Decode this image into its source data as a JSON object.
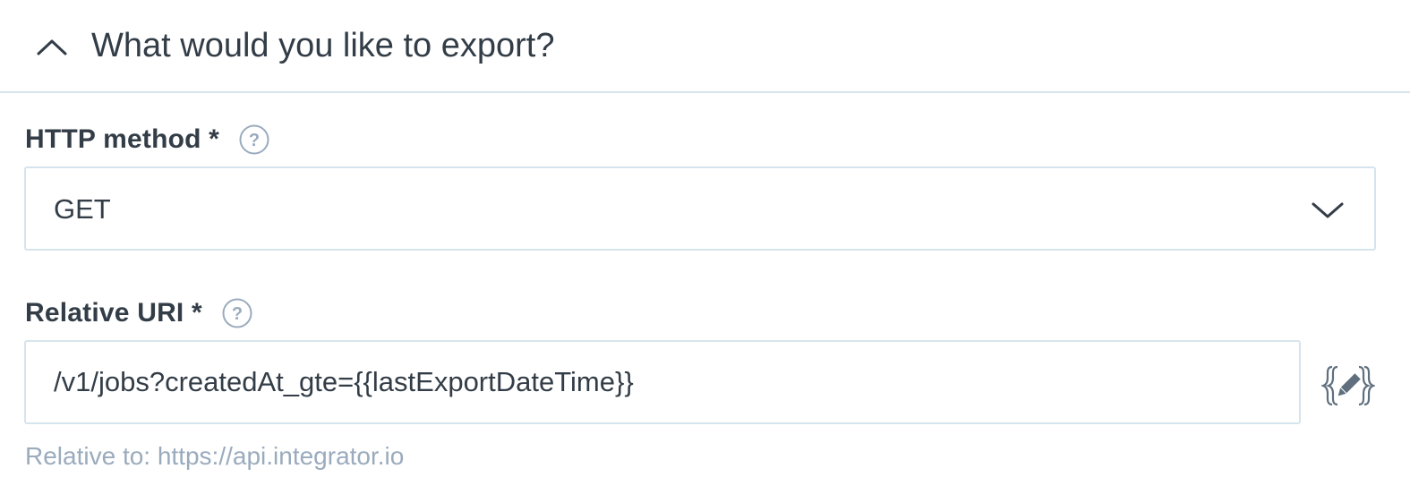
{
  "section": {
    "title": "What would you like to export?",
    "expanded": true
  },
  "http_method": {
    "label": "HTTP method *",
    "help_icon": "question-circle-icon",
    "value": "GET"
  },
  "relative_uri": {
    "label": "Relative URI *",
    "help_icon": "question-circle-icon",
    "value": "/v1/jobs?createdAt_gte={{lastExportDateTime}}",
    "editor_icon": "handlebars-edit-icon",
    "helper_text": "Relative to: https://api.integrator.io"
  },
  "colors": {
    "text": "#333d47",
    "border": "#d6e4ed",
    "muted": "#9aabbd"
  }
}
